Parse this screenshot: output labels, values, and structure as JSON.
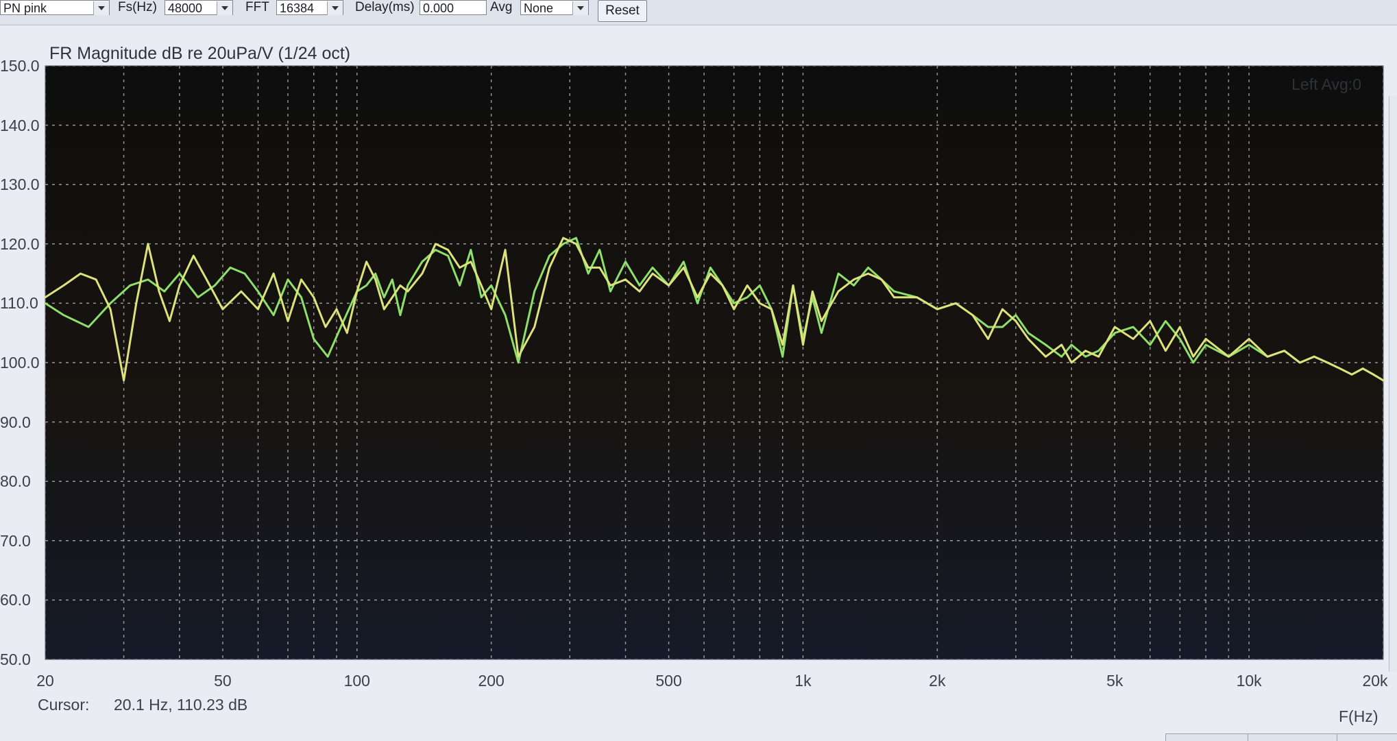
{
  "toolbar": {
    "signal_value": "PN pink",
    "fs_label": "Fs(Hz)",
    "fs_value": "48000",
    "fft_label": "FFT",
    "fft_value": "16384",
    "delay_label": "Delay(ms)",
    "delay_value": "0.000",
    "avg_label": "Avg",
    "avg_value": "None",
    "reset_label": "Reset"
  },
  "chart_data": {
    "type": "line",
    "title": "FR Magnitude dB re 20uPa/V (1/24 oct)",
    "xlabel": "F(Hz)",
    "ylabel": "",
    "x_scale": "log",
    "xlim": [
      20,
      20000
    ],
    "ylim": [
      50,
      150
    ],
    "grid": true,
    "legend_text": "Left  Avg:0",
    "yticks": [
      "150.0",
      "140.0",
      "130.0",
      "120.0",
      "110.0",
      "100.0",
      "90.0",
      "80.0",
      "70.0",
      "60.0",
      "50.0"
    ],
    "xticks": [
      {
        "value": 20,
        "label": "20"
      },
      {
        "value": 50,
        "label": "50"
      },
      {
        "value": 100,
        "label": "100"
      },
      {
        "value": 200,
        "label": "200"
      },
      {
        "value": 500,
        "label": "500"
      },
      {
        "value": 1000,
        "label": "1k"
      },
      {
        "value": 2000,
        "label": "2k"
      },
      {
        "value": 5000,
        "label": "5k"
      },
      {
        "value": 10000,
        "label": "10k"
      },
      {
        "value": 20000,
        "label": "20k"
      }
    ],
    "series": [
      {
        "color": "#8ee06a",
        "x": [
          20,
          22,
          25,
          28,
          31,
          34,
          37,
          40,
          44,
          48,
          52,
          56,
          60,
          65,
          70,
          75,
          80,
          86,
          92,
          100,
          105,
          110,
          115,
          120,
          125,
          130,
          140,
          150,
          160,
          170,
          180,
          190,
          200,
          215,
          230,
          250,
          270,
          290,
          310,
          330,
          350,
          370,
          400,
          430,
          460,
          500,
          540,
          580,
          620,
          660,
          700,
          750,
          800,
          850,
          900,
          950,
          1000,
          1050,
          1100,
          1200,
          1300,
          1400,
          1500,
          1600,
          1800,
          2000,
          2200,
          2400,
          2600,
          2800,
          3000,
          3200,
          3500,
          3800,
          4000,
          4300,
          4600,
          5000,
          5500,
          6000,
          6500,
          7000,
          7500,
          8000,
          9000,
          10000,
          11000,
          12000,
          13000,
          14000,
          15000,
          16000,
          17000,
          18000,
          19000,
          20000
        ],
        "values": [
          110,
          108,
          106,
          110,
          113,
          114,
          112,
          115,
          111,
          113,
          116,
          115,
          112,
          108,
          114,
          111,
          104,
          101,
          106,
          112,
          113,
          115,
          111,
          114,
          108,
          113,
          117,
          119,
          118,
          113,
          119,
          111,
          113,
          108,
          100,
          112,
          118,
          120,
          121,
          115,
          119,
          112,
          117,
          113,
          116,
          113,
          117,
          110,
          116,
          113,
          110,
          111,
          113,
          109,
          101,
          113,
          104,
          111,
          105,
          115,
          113,
          116,
          114,
          112,
          111,
          109,
          110,
          108,
          106,
          106,
          108,
          105,
          103,
          101,
          103,
          101,
          102,
          105,
          106,
          103,
          107,
          104,
          100,
          103,
          101,
          103,
          101,
          102,
          100,
          101,
          100,
          99,
          98,
          99,
          98,
          97
        ]
      },
      {
        "color": "#dde27a",
        "x": [
          20,
          22,
          24,
          26,
          28,
          30,
          32,
          34,
          36,
          38,
          40,
          43,
          46,
          50,
          55,
          60,
          65,
          70,
          75,
          80,
          85,
          90,
          95,
          100,
          105,
          110,
          115,
          120,
          125,
          130,
          140,
          150,
          160,
          170,
          180,
          190,
          200,
          215,
          230,
          250,
          270,
          290,
          310,
          330,
          350,
          370,
          400,
          430,
          460,
          500,
          540,
          580,
          620,
          660,
          700,
          750,
          800,
          850,
          900,
          950,
          1000,
          1050,
          1100,
          1200,
          1300,
          1400,
          1500,
          1600,
          1800,
          2000,
          2200,
          2400,
          2600,
          2800,
          3000,
          3200,
          3500,
          3800,
          4000,
          4300,
          4600,
          5000,
          5500,
          6000,
          6500,
          7000,
          7500,
          8000,
          9000,
          10000,
          11000,
          12000,
          13000,
          14000,
          15000,
          16000,
          17000,
          18000,
          19000,
          20000
        ],
        "values": [
          111,
          113,
          115,
          114,
          109,
          97,
          110,
          120,
          112,
          107,
          113,
          118,
          114,
          109,
          112,
          109,
          115,
          107,
          114,
          111,
          106,
          109,
          105,
          112,
          117,
          114,
          109,
          111,
          113,
          112,
          115,
          120,
          119,
          116,
          117,
          113,
          109,
          119,
          101,
          106,
          116,
          121,
          120,
          116,
          116,
          113,
          114,
          112,
          115,
          113,
          116,
          111,
          115,
          113,
          109,
          113,
          110,
          109,
          103,
          113,
          103,
          112,
          107,
          112,
          114,
          115,
          114,
          111,
          111,
          109,
          110,
          108,
          104,
          109,
          107,
          104,
          101,
          103,
          100,
          102,
          101,
          106,
          104,
          107,
          102,
          106,
          101,
          104,
          101,
          104,
          101,
          102,
          100,
          101,
          100,
          99,
          98,
          99,
          98,
          97
        ]
      }
    ]
  },
  "cursor": {
    "label": "Cursor:",
    "value": "20.1 Hz, 110.23 dB"
  },
  "colors": {
    "plot_bg": "#141414",
    "grid": "#c8c8c8",
    "window_bg": "#e9ecf2"
  }
}
